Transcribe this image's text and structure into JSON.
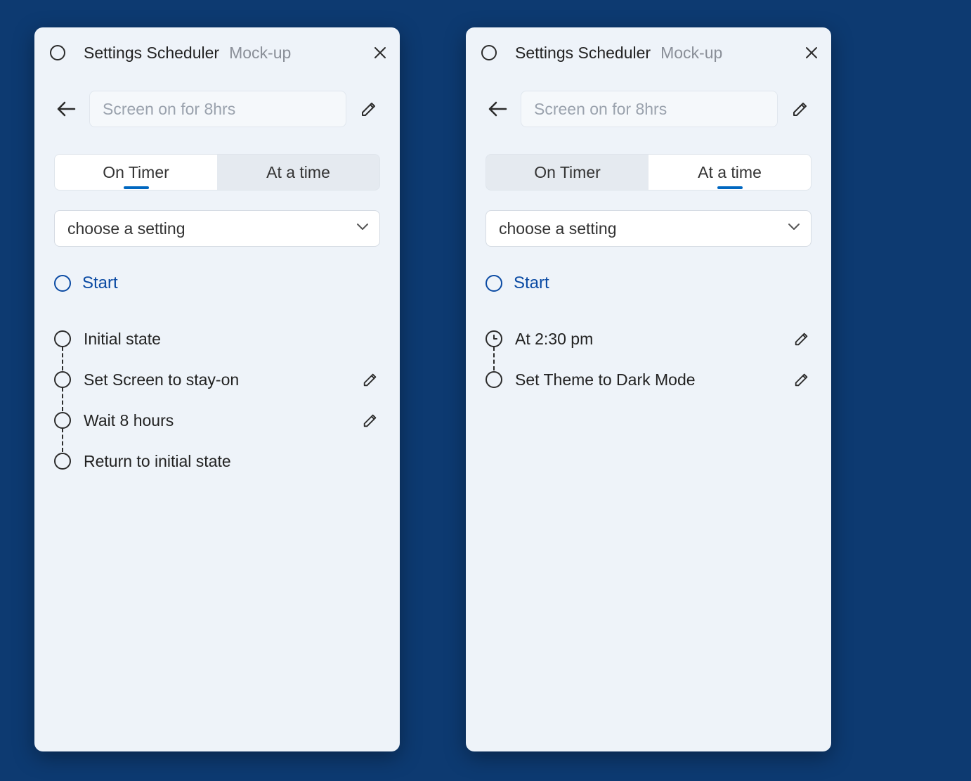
{
  "left": {
    "title": {
      "main": "Settings Scheduler",
      "sub": "Mock-up"
    },
    "name_placeholder": "Screen on for 8hrs",
    "tabs": {
      "timer": "On Timer",
      "time": "At a time",
      "active": "timer"
    },
    "select_placeholder": "choose a setting",
    "start_label": "Start",
    "steps": [
      {
        "label": "Initial state",
        "editable": false,
        "icon": "circle"
      },
      {
        "label": "Set Screen to stay-on",
        "editable": true,
        "icon": "circle"
      },
      {
        "label": "Wait 8 hours",
        "editable": true,
        "icon": "circle"
      },
      {
        "label": "Return to initial state",
        "editable": false,
        "icon": "circle"
      }
    ]
  },
  "right": {
    "title": {
      "main": "Settings Scheduler",
      "sub": "Mock-up"
    },
    "name_placeholder": "Screen on for 8hrs",
    "tabs": {
      "timer": "On Timer",
      "time": "At a time",
      "active": "time"
    },
    "select_placeholder": "choose a setting",
    "start_label": "Start",
    "steps": [
      {
        "label": "At 2:30 pm",
        "editable": true,
        "icon": "clock"
      },
      {
        "label": "Set Theme to Dark Mode",
        "editable": true,
        "icon": "circle"
      }
    ]
  }
}
